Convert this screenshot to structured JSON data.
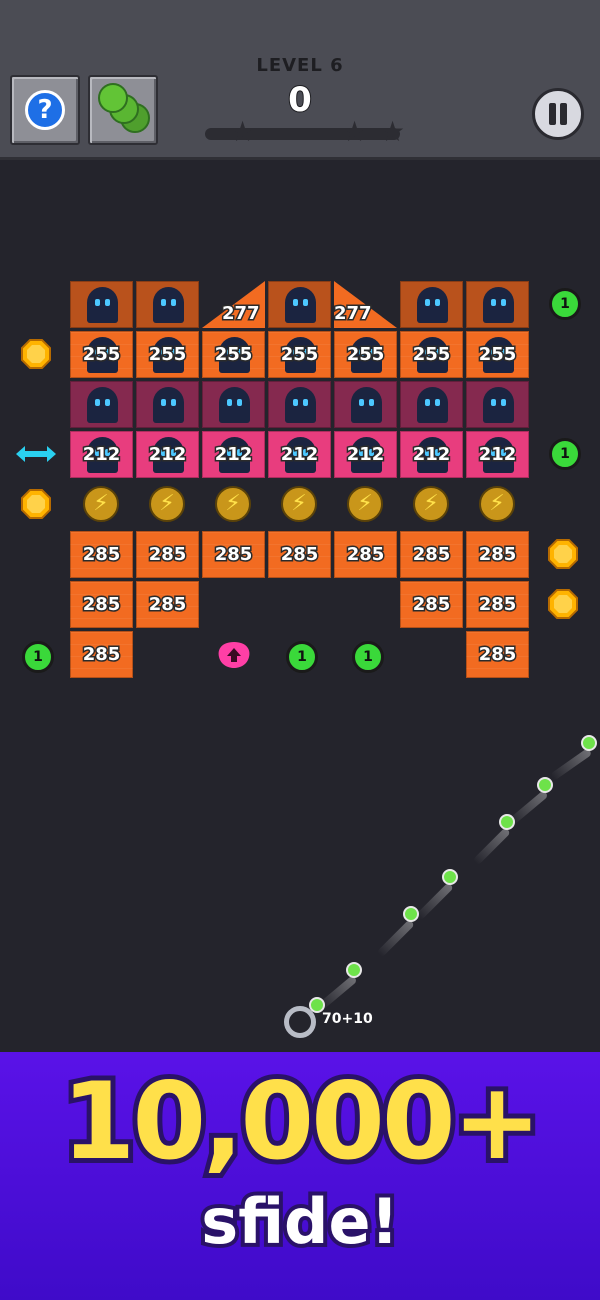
{
  "header": {
    "level_label": "LEVEL 6",
    "score": "0",
    "help_label": "?",
    "star_count": 3
  },
  "bricks": {
    "row1_values": [
      "277",
      "277"
    ],
    "row2_values": [
      "255",
      "255",
      "255",
      "255",
      "255",
      "255",
      "255"
    ],
    "row4_values": [
      "212",
      "212",
      "212",
      "212",
      "212",
      "212",
      "212"
    ],
    "row6_values": [
      "285",
      "285",
      "285",
      "285",
      "285",
      "285",
      "285"
    ],
    "row7_values": [
      "285",
      "285",
      "285",
      "285"
    ],
    "row8_values": [
      "285",
      "285"
    ]
  },
  "pickups": {
    "extra_ball_label": "1"
  },
  "launcher": {
    "ball_count": "70+10"
  },
  "banner": {
    "headline": "10,000+",
    "subline": "sfide!"
  },
  "colors": {
    "brick_orange": "#f26b21",
    "brick_pink": "#e83d7e",
    "brick_purple": "#85294f",
    "banner": "#4a0fd8",
    "headline": "#ffe04a",
    "ball_green": "#6ee24a"
  }
}
